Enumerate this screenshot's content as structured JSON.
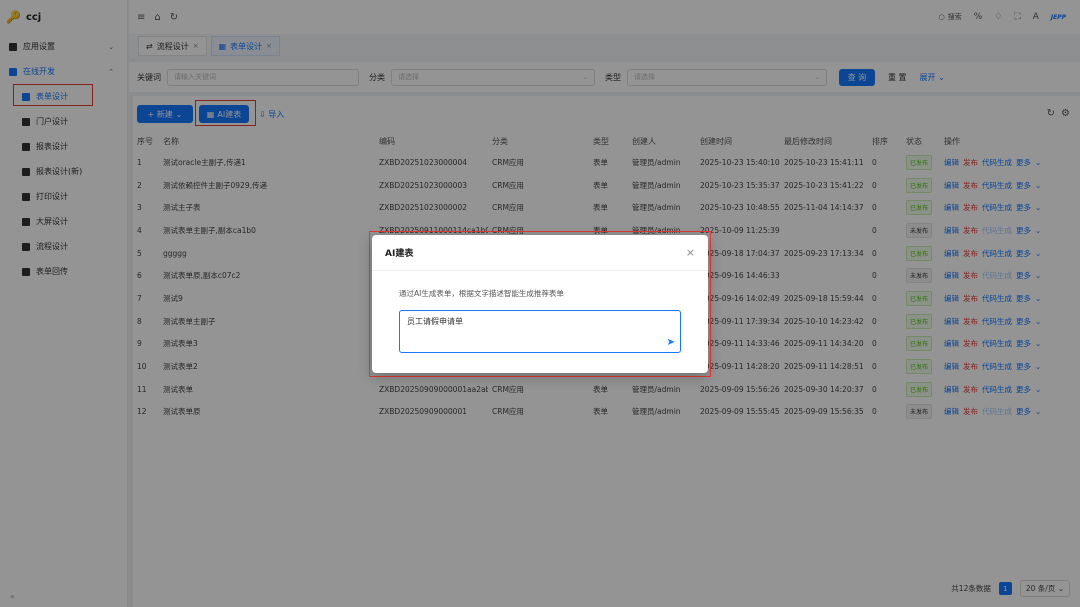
{
  "app": {
    "name": "ccj"
  },
  "sidebar": {
    "items": [
      {
        "label": "应用设置"
      },
      {
        "label": "在线开发"
      }
    ],
    "submenu": [
      {
        "label": "表单设计"
      },
      {
        "label": "门户设计"
      },
      {
        "label": "报表设计"
      },
      {
        "label": "报表设计(新)"
      },
      {
        "label": "打印设计"
      },
      {
        "label": "大屏设计"
      },
      {
        "label": "流程设计"
      },
      {
        "label": "表单回传"
      }
    ],
    "collapse": "«"
  },
  "topbar": {
    "search": "搜索",
    "brand": "JEPP"
  },
  "tabs": [
    {
      "label": "流程设计"
    },
    {
      "label": "表单设计"
    }
  ],
  "filter": {
    "keyword_label": "关键词",
    "keyword_placeholder": "请输入关键词",
    "category_label": "分类",
    "category_placeholder": "请选择",
    "type_label": "类型",
    "type_placeholder": "请选择",
    "query": "查 询",
    "reset": "重 置",
    "expand": "展开"
  },
  "toolbar": {
    "new": "+ 新建",
    "ai": "AI建表",
    "import": "导入"
  },
  "table": {
    "headers": [
      "序号",
      "名称",
      "编码",
      "分类",
      "类型",
      "创建人",
      "创建时间",
      "最后修改时间",
      "排序",
      "状态",
      "操作"
    ],
    "rows": [
      [
        "1",
        "测试oracle主副子,传递1",
        "ZXBD20251023000004",
        "CRM应用",
        "表单",
        "管理员/admin",
        "2025-10-23 15:40:10",
        "2025-10-23 15:41:11",
        "0",
        "已发布"
      ],
      [
        "2",
        "测试依赖控件主副子0929,传递",
        "ZXBD20251023000003",
        "CRM应用",
        "表单",
        "管理员/admin",
        "2025-10-23 15:35:37",
        "2025-10-23 15:41:22",
        "0",
        "已发布"
      ],
      [
        "3",
        "测试主子表",
        "ZXBD20251023000002",
        "CRM应用",
        "表单",
        "管理员/admin",
        "2025-10-23 10:48:55",
        "2025-11-04 14:14:37",
        "0",
        "已发布"
      ],
      [
        "4",
        "测试表单主副子,副本ca1b0",
        "ZXBD20250911000114ca1b0",
        "CRM应用",
        "表单",
        "管理员/admin",
        "2025-10-09 11:25:39",
        "",
        "0",
        "未发布"
      ],
      [
        "5",
        "ggggg",
        "",
        "",
        "",
        "",
        "2025-09-18 17:04:37",
        "2025-09-23 17:13:34",
        "0",
        "已发布"
      ],
      [
        "6",
        "测试表单原,副本c07c2",
        "",
        "",
        "",
        "",
        "2025-09-16 14:46:33",
        "",
        "0",
        "未发布"
      ],
      [
        "7",
        "测试9",
        "",
        "",
        "",
        "",
        "2025-09-16 14:02:49",
        "2025-09-18 15:59:44",
        "0",
        "已发布"
      ],
      [
        "8",
        "测试表单主副子",
        "",
        "",
        "",
        "",
        "2025-09-11 17:39:34",
        "2025-10-10 14:23:42",
        "0",
        "已发布"
      ],
      [
        "9",
        "测试表单3",
        "",
        "",
        "",
        "",
        "2025-09-11 14:33:46",
        "2025-09-11 14:34:20",
        "0",
        "已发布"
      ],
      [
        "10",
        "测试表单2",
        "",
        "",
        "",
        "",
        "2025-09-11 14:28:20",
        "2025-09-11 14:28:51",
        "0",
        "已发布"
      ],
      [
        "11",
        "测试表单",
        "ZXBD20250909000001aa2ab",
        "CRM应用",
        "表单",
        "管理员/admin",
        "2025-09-09 15:56:26",
        "2025-09-30 14:20:37",
        "0",
        "已发布"
      ],
      [
        "12",
        "测试表单原",
        "ZXBD20250909000001",
        "CRM应用",
        "表单",
        "管理员/admin",
        "2025-09-09 15:55:45",
        "2025-09-09 15:56:35",
        "0",
        "未发布"
      ]
    ],
    "ops": [
      "编辑",
      "发布",
      "代码生成",
      "更多"
    ]
  },
  "pager": {
    "total": "共12条数据",
    "page": "1",
    "size": "20 条/页"
  },
  "modal": {
    "title": "AI建表",
    "desc": "通过AI生成表单，根据文字描述智能生成推荐表单",
    "input": "员工请假申请单"
  },
  "colors": {
    "primary": "#1677ff",
    "highlight": "#e53935"
  }
}
